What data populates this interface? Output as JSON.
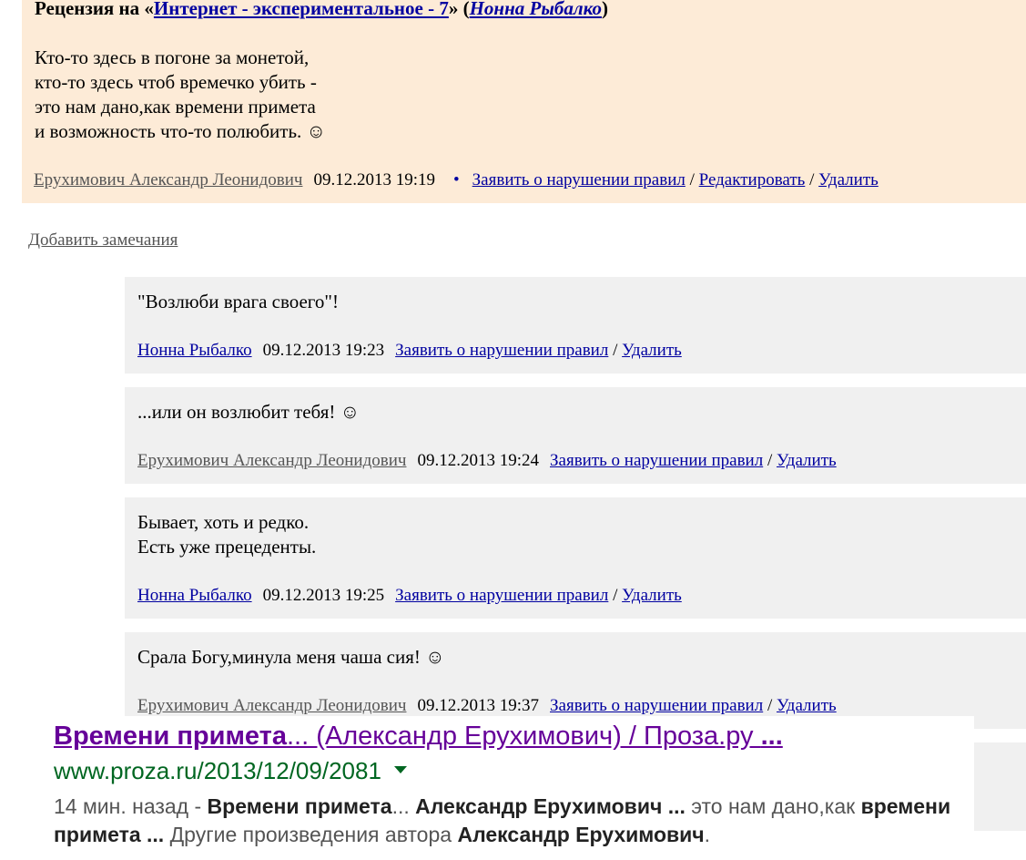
{
  "review": {
    "title_prefix": "Рецензия на «",
    "work_link": "Интернет - экспериментальное - 7",
    "title_mid": "» (",
    "author_link": "Нонна Рыбалко",
    "title_suffix": ")",
    "lines": [
      "Кто-то здесь в погоне за монетой,",
      "кто-то здесь чтоб времечко убить -",
      "это нам дано,как времени примета",
      "и возможность что-то полюбить. ☺"
    ],
    "author": "Ерухимович Александр Леонидович",
    "date": "09.12.2013 19:19",
    "bullet": "•",
    "report": "Заявить о нарушении правил",
    "edit": "Редактировать",
    "delete": "Удалить",
    "sep": "/"
  },
  "add_remarks": "Добавить замечания",
  "comments": [
    {
      "lines": [
        "\"Возлюби врага своего\"!"
      ],
      "author": "Нонна Рыбалко",
      "date": "09.12.2013 19:23",
      "report": "Заявить о нарушении правил",
      "delete": "Удалить"
    },
    {
      "lines": [
        "...или он возлюбит тебя! ☺"
      ],
      "author": "Ерухимович Александр Леонидович",
      "date": "09.12.2013 19:24",
      "report": "Заявить о нарушении правил",
      "delete": "Удалить"
    },
    {
      "lines": [
        "Бывает, хоть и редко.",
        "Есть уже прецеденты."
      ],
      "author": "Нонна Рыбалко",
      "date": "09.12.2013 19:25",
      "report": "Заявить о нарушении правил",
      "delete": "Удалить"
    },
    {
      "lines": [
        "Срала Богу,минула меня чаша сия! ☺"
      ],
      "author": "Ерухимович Александр Леонидович",
      "date": "09.12.2013 19:37",
      "report": "Заявить о нарушении правил",
      "delete": "Удалить"
    }
  ],
  "search_result": {
    "title_bold1": "Времени примета",
    "title_mid": "... (Александр Ерухимович) / Проза.ру ",
    "title_bold2": "...",
    "url": "www.proza.ru/2013/12/09/2081",
    "snip_time": "14 мин. назад - ",
    "snip_b1": "Времени примета",
    "snip_t1": "... ",
    "snip_b2": "Александр Ерухимович ...",
    "snip_t2": " это нам дано,как ",
    "snip_b3": "времени примета ...",
    "snip_t3": " Другие произведения автора ",
    "snip_b4": "Александр Ерухимович",
    "snip_t4": ".",
    "title_color": "#660099",
    "url_color": "#006621"
  }
}
